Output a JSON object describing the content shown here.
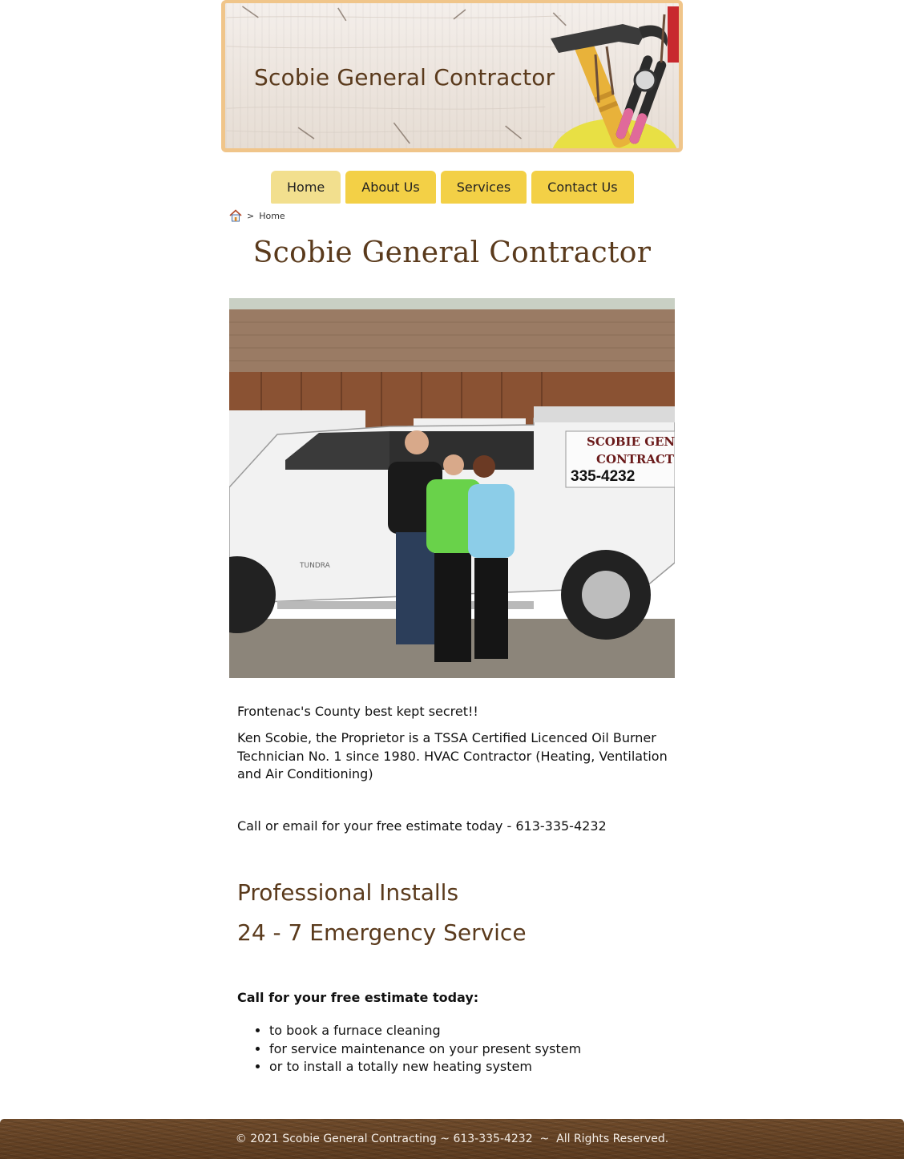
{
  "header": {
    "banner_title": "Scobie General Contractor"
  },
  "nav": {
    "items": [
      {
        "label": "Home",
        "active": true
      },
      {
        "label": "About Us",
        "active": false
      },
      {
        "label": "Services",
        "active": false
      },
      {
        "label": "Contact Us",
        "active": false
      }
    ]
  },
  "breadcrumb": {
    "separator": ">",
    "current": "Home",
    "icon": "home-icon"
  },
  "main": {
    "title": "Scobie General Contractor",
    "photo": {
      "truck_sign_line1": "SCOBIE GEN",
      "truck_sign_line2": "CONTRACT",
      "truck_phone": "335-4232",
      "truck_model": "TUNDRA"
    },
    "intro": "Frontenac's County best kept secret!!",
    "about": "Ken Scobie, the Proprietor is a TSSA Certified Licenced Oil Burner Technician No. 1 since 1980. HVAC Contractor (Heating, Ventilation and Air Conditioning)",
    "cta": "Call or email for your free estimate today - 613-335-4232",
    "heading_installs": "Professional Installs",
    "heading_emergency": "24 - 7 Emergency Service",
    "call_heading": "Call for your free estimate today:",
    "bullets": [
      "to book a furnace cleaning",
      "for service maintenance on your present system",
      "or to install a totally new heating system"
    ]
  },
  "footer": {
    "text": "© 2021 Scobie General Contracting ~ 613-335-4232  ~  All Rights Reserved."
  },
  "colors": {
    "brand_brown": "#5a3a1c",
    "nav_yellow": "#f3d046",
    "nav_active": "#f2df8e",
    "banner_border": "#f0c58a"
  }
}
